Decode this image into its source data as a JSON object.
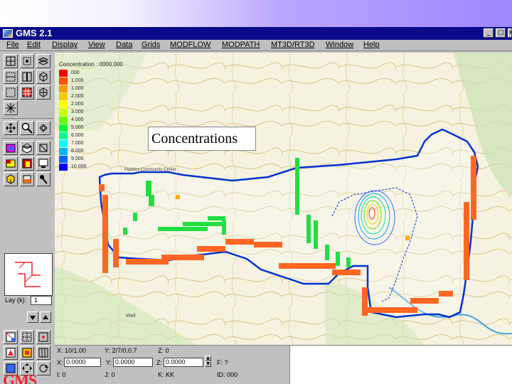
{
  "window": {
    "title": "GMS 2.1"
  },
  "window_buttons": [
    "_",
    "□",
    "×"
  ],
  "menu": [
    "File",
    "Edit",
    "Display",
    "View",
    "Data",
    "Grids",
    "MODFLOW",
    "MODPATH",
    "MT3D/RT3D",
    "Window",
    "Help"
  ],
  "legend": {
    "title": "Concentration : 0000.000",
    "entries": [
      {
        "label": "000",
        "color": "#ff0000"
      },
      {
        "label": "1.000",
        "color": "#ff5000"
      },
      {
        "label": "1.000",
        "color": "#ff9900"
      },
      {
        "label": "2.000",
        "color": "#ffc800"
      },
      {
        "label": "2.000",
        "color": "#ffff00"
      },
      {
        "label": "3.000",
        "color": "#c8ff00"
      },
      {
        "label": "4.000",
        "color": "#66ff00"
      },
      {
        "label": "5.000",
        "color": "#00ff33"
      },
      {
        "label": "6.000",
        "color": "#00ff99"
      },
      {
        "label": "7.000",
        "color": "#00ffff"
      },
      {
        "label": "8.000",
        "color": "#00b3ff"
      },
      {
        "label": "9.000",
        "color": "#0066ff"
      },
      {
        "label": "10.000",
        "color": "#0000ff"
      }
    ]
  },
  "map_labels": {
    "community_center": "Maddox Community Center",
    "well": "Well"
  },
  "callout": "Concentrations",
  "layer": {
    "label": "Lay (k):",
    "value": "1"
  },
  "status": {
    "x_label": "X:",
    "x_value": "0.0000",
    "y_label": "Y:",
    "y_value": "0.0000",
    "z_label": "Z:",
    "z_value": "0.0000",
    "readout_x": "X: 10/1.00",
    "readout_y": "Y: 2/7/0.0.7",
    "readout_z": "Z: 0",
    "f_label": "F: ?",
    "row_i": "I: 0",
    "row_j": "J: 0",
    "row_k": "K: KK",
    "row_id": "ID: 000"
  },
  "logo_text": "GMS",
  "colors": {
    "titlebar": "#0a0a8a",
    "boundary": "#0033cc",
    "specified_head": "#ff6600",
    "river": "#00cc33",
    "contour": "#0000cc",
    "well_marker": "#ffaa00"
  }
}
